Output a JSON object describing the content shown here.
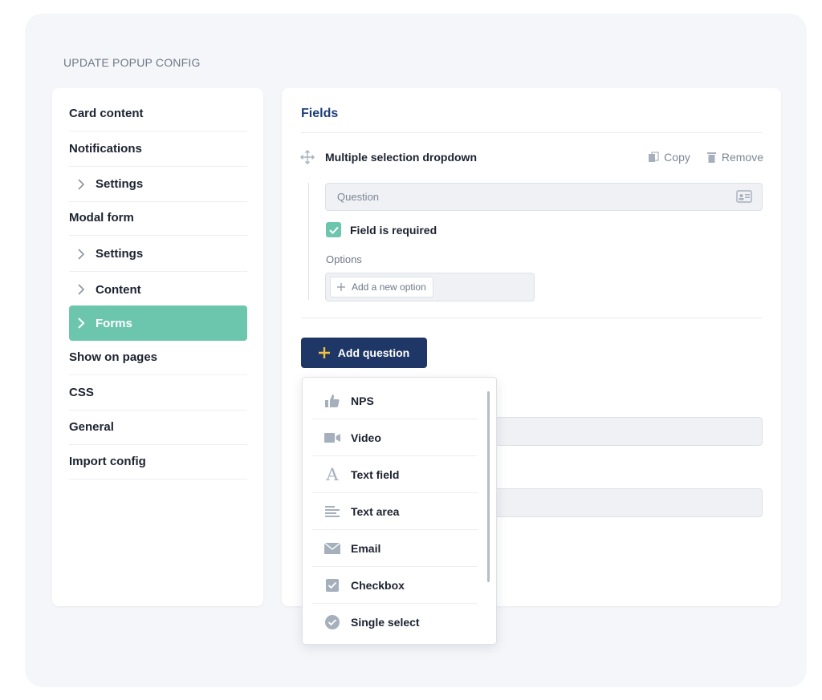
{
  "page": {
    "title": "UPDATE POPUP CONFIG"
  },
  "sidebar": {
    "items": [
      {
        "label": "Card content"
      },
      {
        "label": "Notifications"
      },
      {
        "label": "Settings"
      },
      {
        "label": "Modal form"
      },
      {
        "label": "Settings"
      },
      {
        "label": "Content"
      },
      {
        "label": "Forms",
        "active": true
      },
      {
        "label": "Show on pages"
      },
      {
        "label": "CSS"
      },
      {
        "label": "General"
      },
      {
        "label": "Import config"
      }
    ]
  },
  "main": {
    "section_title": "Fields",
    "field": {
      "type_label": "Multiple selection dropdown",
      "copy_label": "Copy",
      "remove_label": "Remove",
      "question_placeholder": "Question",
      "required_label": "Field is required",
      "required_checked": true,
      "options_label": "Options",
      "add_option_label": "Add a new option"
    },
    "add_question_label": "Add question"
  },
  "dropdown": {
    "items": [
      {
        "label": "NPS",
        "icon": "thumbs-up-icon"
      },
      {
        "label": "Video",
        "icon": "video-camera-icon"
      },
      {
        "label": "Text field",
        "icon": "letter-a-icon"
      },
      {
        "label": "Text area",
        "icon": "text-lines-icon"
      },
      {
        "label": "Email",
        "icon": "envelope-icon"
      },
      {
        "label": "Checkbox",
        "icon": "checkbox-icon"
      },
      {
        "label": "Single select",
        "icon": "check-circle-icon"
      }
    ]
  },
  "colors": {
    "accent_green": "#6cc6ae",
    "primary_navy": "#1e3766",
    "title_blue": "#1e3f7a",
    "plus_yellow": "#f5c23d"
  }
}
